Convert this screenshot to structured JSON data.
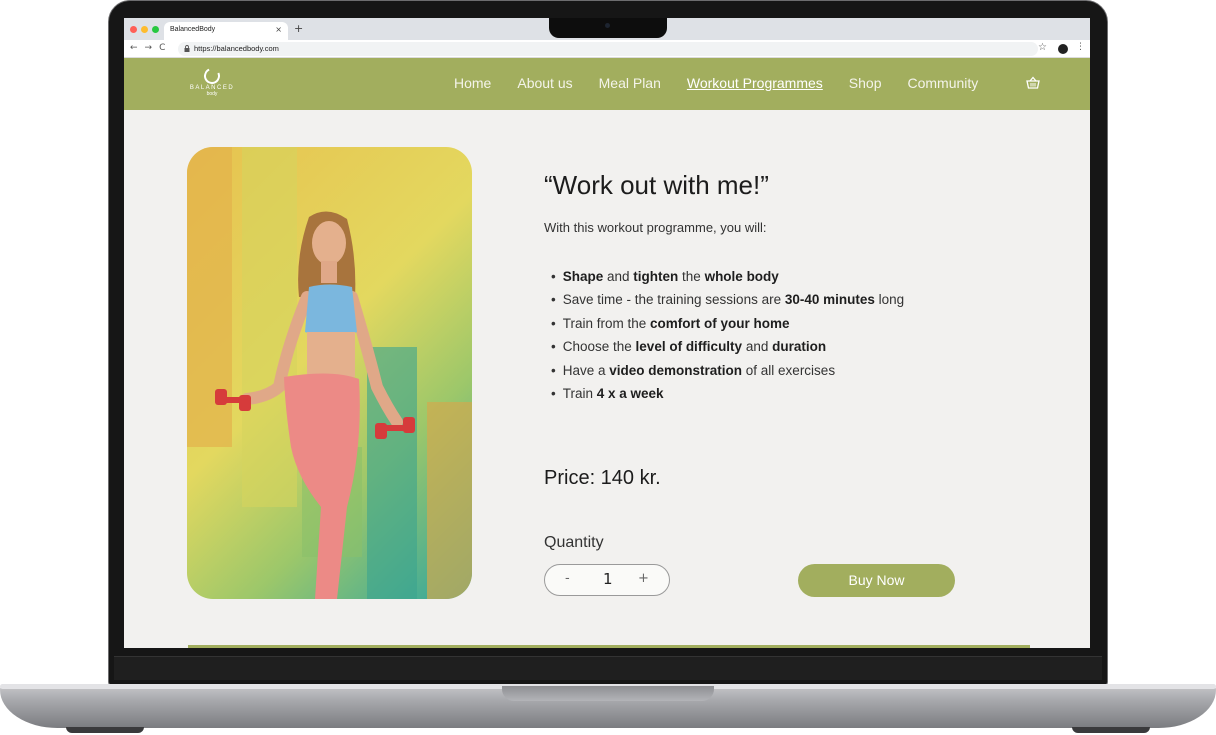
{
  "browser": {
    "tab_title": "BalancedBody",
    "tab_close": "×",
    "new_tab": "+",
    "back": "←",
    "forward": "→",
    "reload": "C",
    "url": "https://balancedbody.com",
    "star": "☆",
    "menu": "⋮"
  },
  "site": {
    "logo_text": "BALANCED",
    "logo_sub": "body",
    "nav": [
      {
        "label": "Home",
        "active": false
      },
      {
        "label": "About us",
        "active": false
      },
      {
        "label": "Meal Plan",
        "active": false
      },
      {
        "label": "Workout Programmes",
        "active": true
      },
      {
        "label": "Shop",
        "active": false
      },
      {
        "label": "Community",
        "active": false
      }
    ],
    "accent_color": "#a2ae5e"
  },
  "product": {
    "heading": "“Work out with me!”",
    "intro": "With this workout programme, you will:",
    "bullets": [
      [
        {
          "t": "Shape",
          "b": true
        },
        {
          "t": " and ",
          "b": false
        },
        {
          "t": "tighten",
          "b": true
        },
        {
          "t": " the ",
          "b": false
        },
        {
          "t": "whole body",
          "b": true
        }
      ],
      [
        {
          "t": "Save time - the training sessions are ",
          "b": false
        },
        {
          "t": "30-40 minutes",
          "b": true
        },
        {
          "t": " long",
          "b": false
        }
      ],
      [
        {
          "t": "Train from the ",
          "b": false
        },
        {
          "t": "comfort of your home",
          "b": true
        }
      ],
      [
        {
          "t": "Choose the ",
          "b": false
        },
        {
          "t": "level of difficulty",
          "b": true
        },
        {
          "t": " and ",
          "b": false
        },
        {
          "t": "duration",
          "b": true
        }
      ],
      [
        {
          "t": "Have a ",
          "b": false
        },
        {
          "t": "video demonstration",
          "b": true
        },
        {
          "t": " of all exercises",
          "b": false
        }
      ],
      [
        {
          "t": "Train ",
          "b": false
        },
        {
          "t": "4 x a week",
          "b": true
        }
      ]
    ],
    "price": "Price: 140 kr.",
    "quantity_label": "Quantity",
    "qty_minus": "-",
    "qty_value": "1",
    "qty_plus": "+",
    "buy_label": "Buy Now"
  }
}
